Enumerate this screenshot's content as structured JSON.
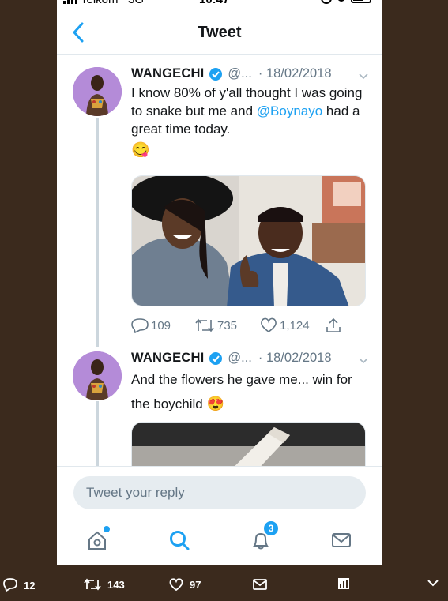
{
  "status_bar": {
    "carrier": "Telkom",
    "network": "3G",
    "time": "10:47"
  },
  "header": {
    "title": "Tweet",
    "back_icon": "chevron-left-icon"
  },
  "tweets": [
    {
      "name": "WANGECHI",
      "handle": "@...",
      "date": "· 18/02/2018",
      "text_before": "I know 80% of y'all thought I was going to snake but me and ",
      "mention": "@Boynayo",
      "text_after": " had a great time today.",
      "emoji": "😋",
      "counts": {
        "replies": "109",
        "retweets": "735",
        "likes": "1,124"
      }
    },
    {
      "name": "WANGECHI",
      "handle": "@...",
      "date": "· 18/02/2018",
      "text": "And the flowers he gave me... win for the boychild",
      "emoji": "😍"
    }
  ],
  "reply": {
    "placeholder": "Tweet your reply"
  },
  "tabbar": {
    "notifications_badge": "3"
  },
  "desktop_bar": {
    "replies": "12",
    "retweets": "143",
    "likes": "97"
  },
  "colors": {
    "accent": "#1da1f2",
    "muted": "#657786",
    "background": "#3b2a1d"
  }
}
